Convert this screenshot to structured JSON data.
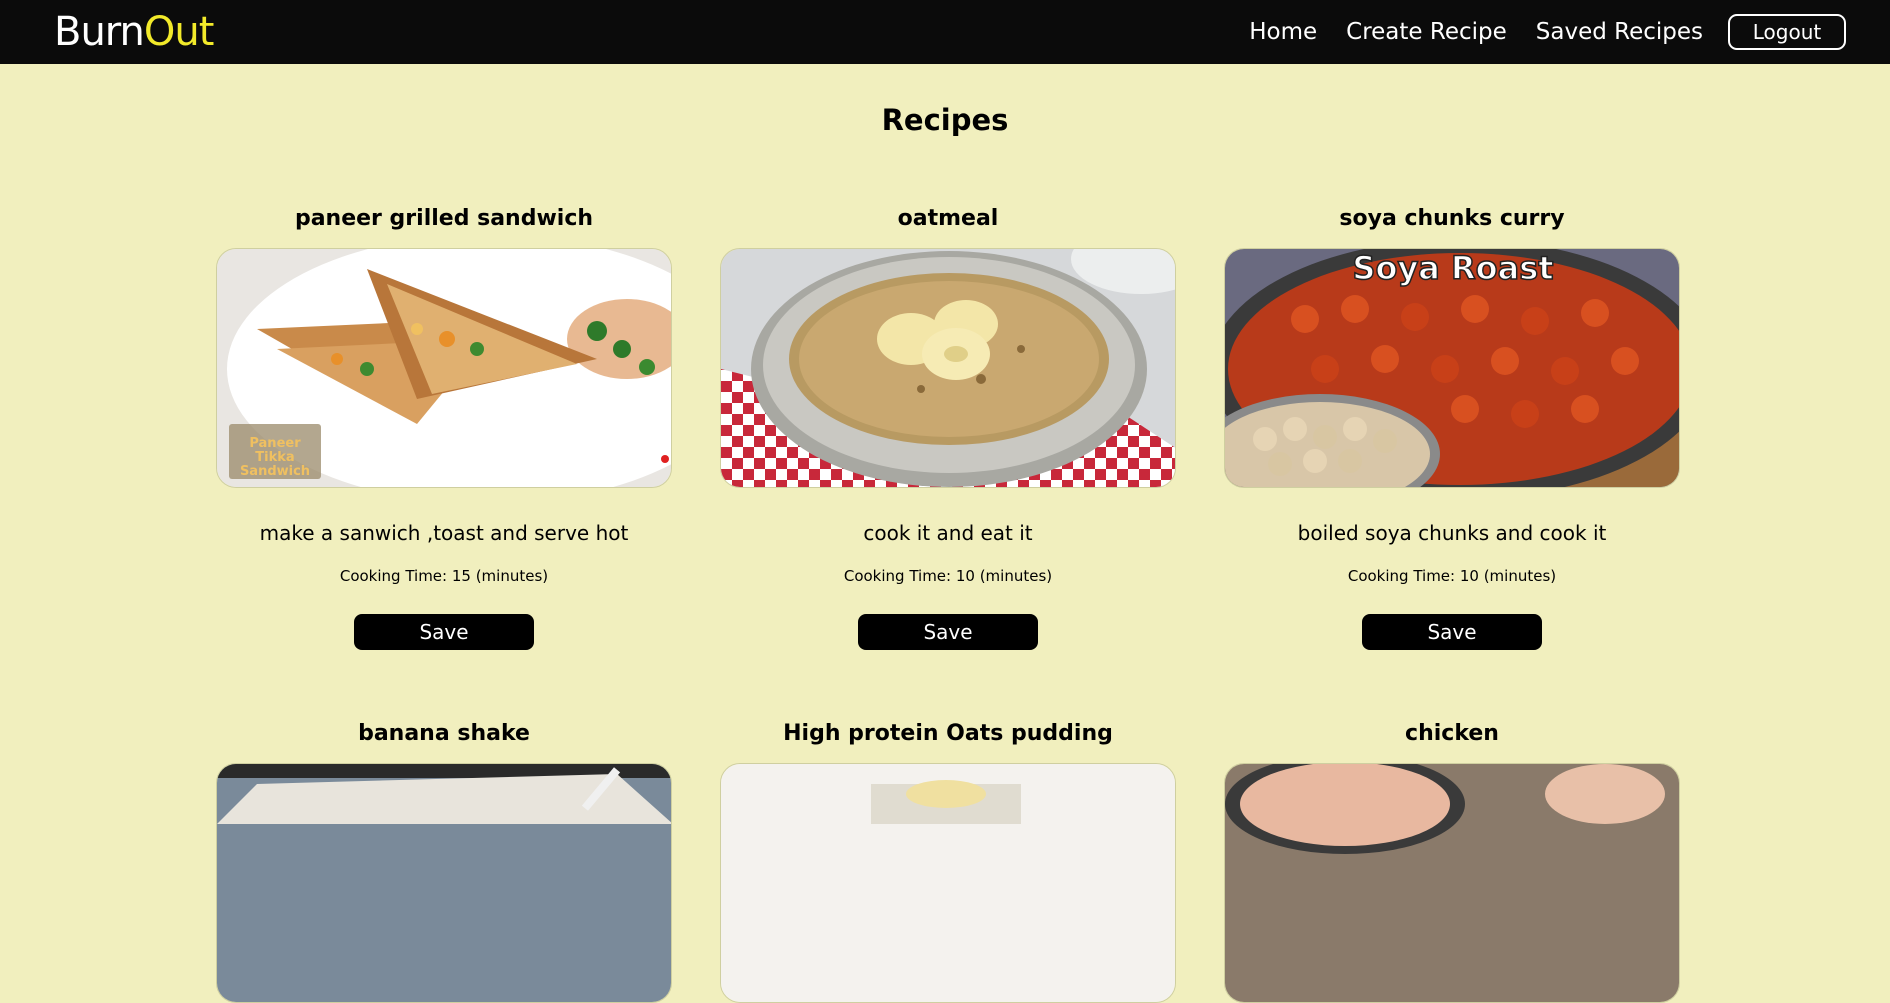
{
  "brand": {
    "part1": "Burn",
    "part2": "Out"
  },
  "nav": {
    "home": "Home",
    "create": "Create Recipe",
    "saved": "Saved Recipes",
    "logout": "Logout"
  },
  "page": {
    "title": "Recipes"
  },
  "recipes": [
    {
      "name": "paneer grilled sandwich",
      "instructions": "make a sanwich ,toast and serve hot",
      "cooking_time": "Cooking Time: 15 (minutes)",
      "save_label": "Save",
      "image_text": "Paneer Tikka Sandwich"
    },
    {
      "name": "oatmeal",
      "instructions": "cook it and eat it",
      "cooking_time": "Cooking Time: 10 (minutes)",
      "save_label": "Save"
    },
    {
      "name": "soya chunks curry",
      "instructions": "boiled soya chunks and cook it",
      "cooking_time": "Cooking Time: 10 (minutes)",
      "save_label": "Save",
      "image_text": "Soya Roast"
    },
    {
      "name": "banana shake"
    },
    {
      "name": "High protein Oats pudding"
    },
    {
      "name": "chicken"
    }
  ],
  "colors": {
    "background": "#f1efbe",
    "navbar": "#0b0b0b",
    "brand_accent": "#f2ea2a",
    "button": "#000000"
  }
}
